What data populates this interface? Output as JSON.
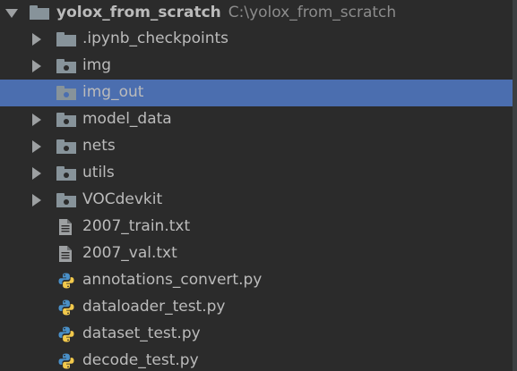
{
  "project_tree": {
    "root": {
      "name": "yolox_from_scratch",
      "path": "C:\\yolox_from_scratch"
    },
    "items": [
      {
        "label": ".ipynb_checkpoints",
        "kind": "folder",
        "expandable": true
      },
      {
        "label": "img",
        "kind": "folder",
        "expandable": true
      },
      {
        "label": "img_out",
        "kind": "folder",
        "expandable": false,
        "selected": true
      },
      {
        "label": "model_data",
        "kind": "folder",
        "expandable": true
      },
      {
        "label": "nets",
        "kind": "folder",
        "expandable": true
      },
      {
        "label": "utils",
        "kind": "folder",
        "expandable": true
      },
      {
        "label": "VOCdevkit",
        "kind": "folder",
        "expandable": true
      },
      {
        "label": "2007_train.txt",
        "kind": "text-file"
      },
      {
        "label": "2007_val.txt",
        "kind": "text-file"
      },
      {
        "label": "annotations_convert.py",
        "kind": "python-file"
      },
      {
        "label": "dataloader_test.py",
        "kind": "python-file"
      },
      {
        "label": "dataset_test.py",
        "kind": "python-file"
      },
      {
        "label": "decode_test.py",
        "kind": "python-file"
      }
    ]
  },
  "colors": {
    "background": "#2b2b2b",
    "selection": "#4b6eaf",
    "text": "#bbbbbb",
    "path_text": "#8c8c8c",
    "folder_icon": "#87939a"
  },
  "icons": {
    "expanded": "chevron-down-icon",
    "collapsed": "chevron-right-icon",
    "folder": "folder-icon",
    "text_file": "text-file-icon",
    "python_file": "python-file-icon"
  }
}
